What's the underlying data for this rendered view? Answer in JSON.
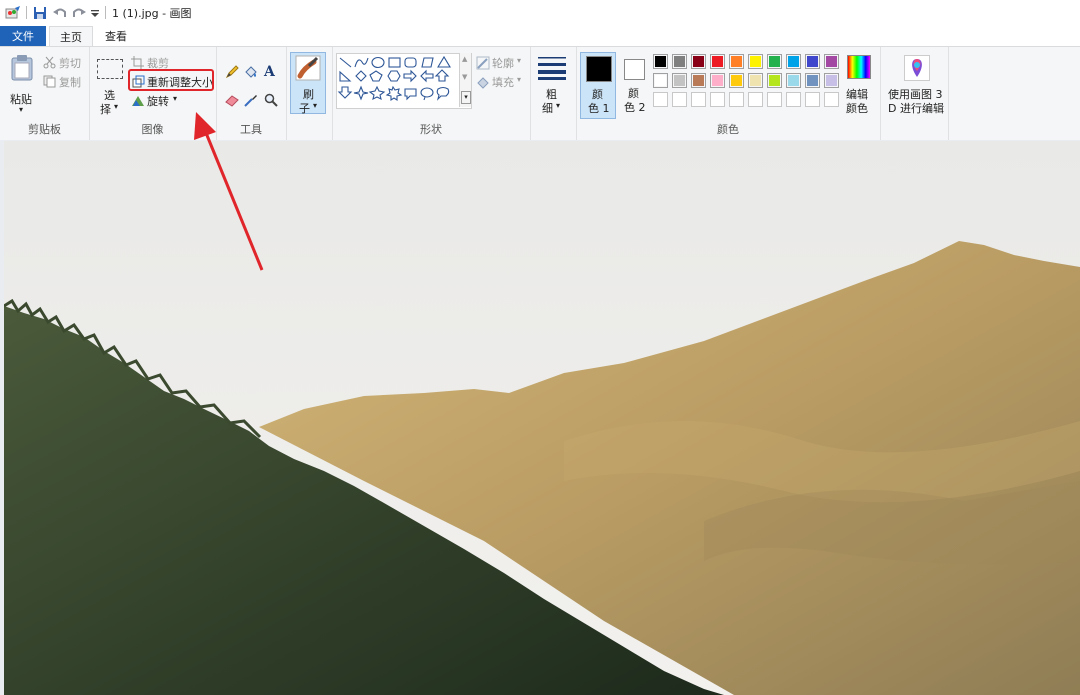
{
  "window": {
    "title": "1 (1).jpg - 画图"
  },
  "tabs": {
    "file": "文件",
    "home": "主页",
    "view": "查看"
  },
  "clipboard": {
    "paste": "粘贴",
    "cut": "剪切",
    "copy": "复制",
    "group_label": "剪贴板"
  },
  "image": {
    "select_line1": "选",
    "select_line2": "择",
    "crop": "裁剪",
    "resize": "重新调整大小",
    "rotate": "旋转",
    "group_label": "图像"
  },
  "tools": {
    "group_label": "工具",
    "text_tool_glyph": "A"
  },
  "brushes": {
    "line1": "刷",
    "line2": "子"
  },
  "shapes": {
    "outline": "轮廓",
    "fill": "填充",
    "group_label": "形状"
  },
  "size": {
    "line1": "粗",
    "line2": "细"
  },
  "colors": {
    "color1_line1": "颜",
    "color1_line2": "色 1",
    "color2_line1": "颜",
    "color2_line2": "色 2",
    "edit_line1": "编辑",
    "edit_line2": "颜色",
    "group_label": "颜色",
    "palette_row1": [
      "#000000",
      "#7f7f7f",
      "#880015",
      "#ed1c24",
      "#ff7f27",
      "#fff200",
      "#22b14c",
      "#00a2e8",
      "#3f48cc",
      "#a349a4"
    ],
    "palette_row2": [
      "#ffffff",
      "#c3c3c3",
      "#b97a57",
      "#ffaec9",
      "#ffc90e",
      "#efe4b0",
      "#b5e61d",
      "#99d9ea",
      "#7092be",
      "#c8bfe7"
    ],
    "color1_value": "#000000",
    "color2_value": "#ffffff"
  },
  "paint3d": {
    "line1": "使用画图 3",
    "line2": "D 进行编辑"
  }
}
